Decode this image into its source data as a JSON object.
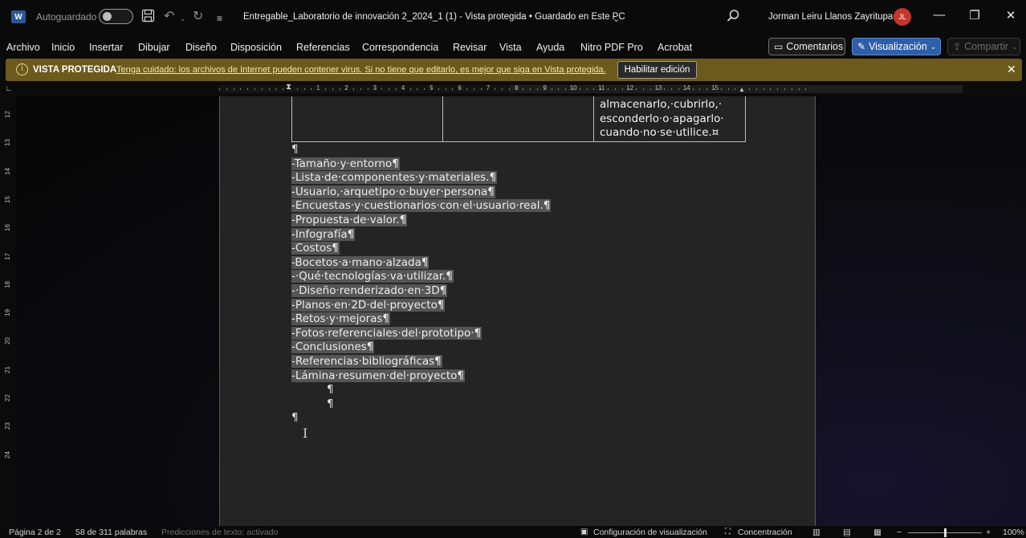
{
  "titlebar": {
    "autosave_label": "Autoguardado",
    "doc_title": "Entregable_Laboratorio de innovación 2_2024_1 (1)  -  Vista protegida  •  Guardado en Este PC",
    "user_name": "Jorman Leiru Llanos Zayritupac",
    "user_initials": "JL",
    "icons": [
      "word-logo-icon",
      "save-icon",
      "undo-icon",
      "redo-icon",
      "customize-icon",
      "search-icon",
      "minimize-icon",
      "restore-icon",
      "close-icon"
    ]
  },
  "menu": {
    "items": [
      "Archivo",
      "Inicio",
      "Insertar",
      "Dibujar",
      "Diseño",
      "Disposición",
      "Referencias",
      "Correspondencia",
      "Revisar",
      "Vista",
      "Ayuda",
      "Nitro PDF Pro",
      "Acrobat"
    ],
    "comments": "Comentarios",
    "view_mode": "Visualización",
    "share": "Compartir"
  },
  "protected": {
    "title": "VISTA PROTEGIDA",
    "message": "Tenga cuidado: los archivos de Internet pueden contener virus. Si no tiene que editarlo, es mejor que siga en Vista protegida.",
    "enable_button": "Habilitar edición"
  },
  "ruler": {
    "h_marks": [
      "1",
      "2",
      "3",
      "4",
      "5",
      "6",
      "7",
      "8",
      "9",
      "10",
      "11",
      "12",
      "13",
      "14",
      "15"
    ],
    "v_marks": [
      "12",
      "13",
      "14",
      "15",
      "16",
      "17",
      "18",
      "19",
      "20",
      "21",
      "22",
      "23",
      "24"
    ]
  },
  "document": {
    "table_cell_text": "almacenarlo,·cubrirlo,· esconderlo·o·apagarlo· cuando·no·se·utilice.¤",
    "empty_pilcrow": "¶",
    "list": [
      "-Tamaño·y·entorno¶",
      "-Lista·de·componentes·y·materiales.¶",
      "-Usuario,·arquetipo·o·buyer·persona¶",
      "-Encuestas·y·cuestionarios·con·el·usuario·real.¶",
      "-Propuesta·de·valor.¶",
      "-Infografía¶",
      "-Costos¶",
      "-Bocetos·a·mano·alzada¶",
      "-·Qué·tecnologías·va·utilizar.¶",
      "-·Diseño·renderizado·en·3D¶",
      "-Planos·en·2D·del·proyecto¶",
      "-Retos·y·mejoras¶",
      "-Fotos·referenciales·del·prototipo·¶",
      "-Conclusiones¶",
      "-Referencias·bibliográficas¶",
      "-Lámina·resumen·del·proyecto¶"
    ],
    "trailing_pilcrows": [
      "¶",
      "¶",
      "¶"
    ]
  },
  "status": {
    "page": "Página 2 de 2",
    "words": "58 de 311 palabras",
    "predictions": "Predicciones de texto: activado",
    "display_settings": "Configuración de visualización",
    "focus": "Concentración",
    "zoom": "100%"
  }
}
